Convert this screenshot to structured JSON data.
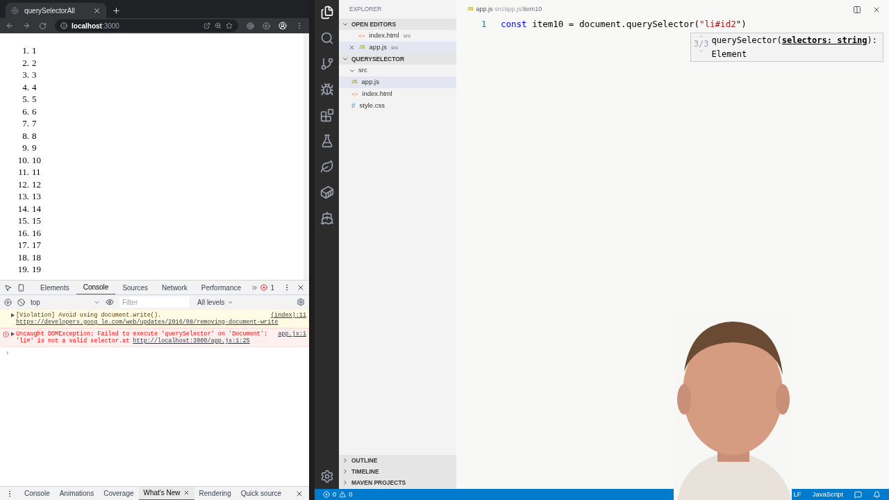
{
  "browser": {
    "tab_title": "querySelectorAll",
    "url_host": "localhost",
    "url_port": ":3000",
    "page_list": [
      {
        "number": "1.",
        "text": "1"
      },
      {
        "number": "2.",
        "text": "2"
      },
      {
        "number": "3.",
        "text": "3"
      },
      {
        "number": "4.",
        "text": "4"
      },
      {
        "number": "5.",
        "text": "5"
      },
      {
        "number": "6.",
        "text": "6"
      },
      {
        "number": "7.",
        "text": "7"
      },
      {
        "number": "8.",
        "text": "8"
      },
      {
        "number": "9.",
        "text": "9"
      },
      {
        "number": "10.",
        "text": "10"
      },
      {
        "number": "11.",
        "text": "11"
      },
      {
        "number": "12.",
        "text": "12"
      },
      {
        "number": "13.",
        "text": "13"
      },
      {
        "number": "14.",
        "text": "14"
      },
      {
        "number": "15.",
        "text": "15"
      },
      {
        "number": "16.",
        "text": "16"
      },
      {
        "number": "17.",
        "text": "17"
      },
      {
        "number": "18.",
        "text": "18"
      },
      {
        "number": "19.",
        "text": "19"
      }
    ]
  },
  "devtools": {
    "tabs": [
      {
        "label": "Elements",
        "selected": false
      },
      {
        "label": "Console",
        "selected": true
      },
      {
        "label": "Sources",
        "selected": false
      },
      {
        "label": "Network",
        "selected": false
      },
      {
        "label": "Performance",
        "selected": false
      }
    ],
    "error_count": "1",
    "context": "top",
    "filter_placeholder": "Filter",
    "levels": "All levels",
    "messages": [
      {
        "kind": "warning",
        "text": "[Violation] Avoid using document.write(). ",
        "link": "https://developers.goog",
        "link_cont": "le.com/web/updates/2016/08/removing-document-write",
        "source": "(index):11"
      },
      {
        "kind": "error",
        "text": "Uncaught DOMException: Failed to execute 'querySelector' on 'Document': 'li#' is not a valid selector.",
        "at": "at ",
        "link": "http://localhost:3000/app.js:1:25",
        "source": "app.js:1"
      }
    ],
    "prompt": "›",
    "drawer_tabs": [
      {
        "label": "Console",
        "selected": false,
        "closable": false
      },
      {
        "label": "Animations",
        "selected": false,
        "closable": false
      },
      {
        "label": "Coverage",
        "selected": false,
        "closable": false
      },
      {
        "label": "What's New",
        "selected": true,
        "closable": true
      },
      {
        "label": "Rendering",
        "selected": false,
        "closable": false
      },
      {
        "label": "Quick source",
        "selected": false,
        "closable": false
      }
    ]
  },
  "editor": {
    "explorer_title": "EXPLORER",
    "sections": [
      {
        "title": "OPEN EDITORS",
        "items": [
          {
            "kind": "html",
            "icon": "<>",
            "name": "index.html",
            "hint": "src",
            "selected": false,
            "closable": false
          },
          {
            "kind": "js",
            "icon": "JS",
            "name": "app.js",
            "hint": "src",
            "selected": true,
            "closable": true
          }
        ]
      },
      {
        "title": "QUERYSELECTOR",
        "folder": "src",
        "items": [
          {
            "kind": "js",
            "icon": "JS",
            "name": "app.js",
            "selected": true
          },
          {
            "kind": "html",
            "icon": "<>",
            "name": "index.html",
            "selected": false
          },
          {
            "kind": "css",
            "icon": "#",
            "name": "style.css",
            "selected": false
          }
        ]
      }
    ],
    "bottom_sections": [
      "OUTLINE",
      "TIMELINE",
      "MAVEN PROJECTS"
    ],
    "breadcrumb": {
      "icon": "JS",
      "file": "app.js",
      "path": "src/app.js/",
      "symbol": "item10"
    },
    "line_number": "1",
    "code": {
      "keyword": "const",
      "name": " item10 = document.querySelector(",
      "string": "\"li#id2",
      "rest": "\")"
    },
    "hint": {
      "counter": "3/3",
      "signature": "querySelector(",
      "param": "selectors: string",
      "after": "):",
      "returns": "Element"
    },
    "status": {
      "errors": "0",
      "warnings": "0",
      "eol": "LF",
      "language": "JavaScript"
    }
  }
}
